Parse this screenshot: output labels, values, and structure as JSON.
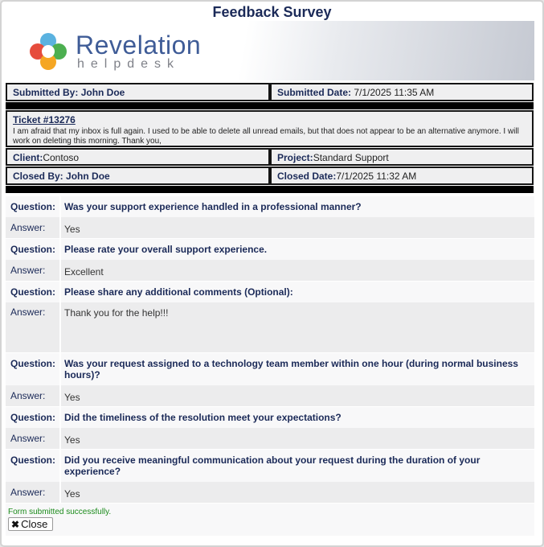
{
  "dialog": {
    "title": "Feedback Survey"
  },
  "brand": {
    "name": "Revelation",
    "tagline": "helpdesk"
  },
  "ticket_info": {
    "submitted_by_label": "Submitted By:",
    "submitted_by": "John Doe",
    "submitted_date_label": "Submitted Date:",
    "submitted_date": "7/1/2025 11:35 AM",
    "ticket_link": "Ticket #13276",
    "description": "I am afraid that my inbox is full again. I used to be able to delete all unread emails, but that does not appear to be an alternative anymore. I will work on deleting this morning. Thank you,",
    "client_label": "Client:",
    "client": "Contoso",
    "project_label": "Project:",
    "project": "Standard Support",
    "closed_by_label": "Closed By:",
    "closed_by": "John Doe",
    "closed_date_label": "Closed Date:",
    "closed_date": "7/1/2025 11:32 AM"
  },
  "survey": {
    "question_label": "Question:",
    "answer_label": "Answer:",
    "items": [
      {
        "question": "Was your support experience handled in a professional manner?",
        "answer": "Yes"
      },
      {
        "question": "Please rate your overall support experience.",
        "answer": "Excellent"
      },
      {
        "question": "Please share any additional comments (Optional):",
        "answer": "Thank you for the help!!!"
      },
      {
        "question": "Was your request assigned to a technology team member within one hour (during normal business hours)?",
        "answer": "Yes"
      },
      {
        "question": "Did the timeliness of the resolution meet your expectations?",
        "answer": "Yes"
      },
      {
        "question": "Did you receive meaningful communication about your request during the duration of your experience?",
        "answer": "Yes"
      }
    ]
  },
  "footer": {
    "status": "Form submitted successfully.",
    "close_label": "Close",
    "status_color": "#1a8a1a"
  },
  "colors": {
    "accent": "#1b2a58",
    "brand": "#3f5c97"
  }
}
